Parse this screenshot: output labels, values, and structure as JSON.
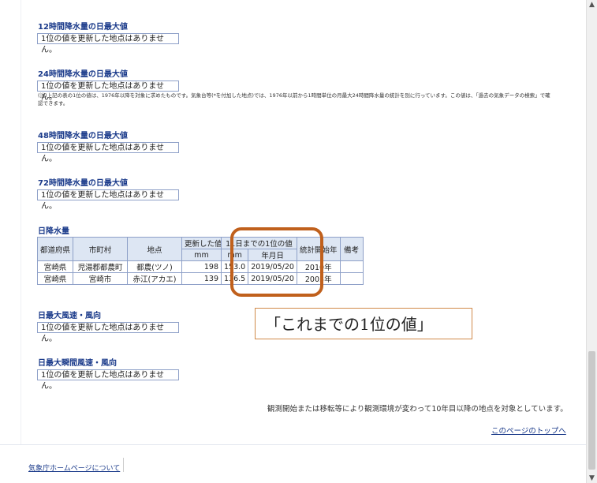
{
  "sections": {
    "s12h": {
      "title": "12時間降水量の日最大値",
      "notice": "1位の値を更新した地点はありません。"
    },
    "s24h": {
      "title": "24時間降水量の日最大値",
      "notice": "1位の値を更新した地点はありません。"
    },
    "footnote": "(注)上記の表の1位の値は、1976年以降を対象に求めたものです。気象台等(*を付加した地点)では、1976年以前から1時間単位の月最大24時間降水量の統計を別に行っています。この値は、「過去の気象データの検索」で確認できます。",
    "s48h": {
      "title": "48時間降水量の日最大値",
      "notice": "1位の値を更新した地点はありません。"
    },
    "s72h": {
      "title": "72時間降水量の日最大値",
      "notice": "1位の値を更新した地点はありません。"
    },
    "daily": {
      "title": "日降水量"
    },
    "wind": {
      "title": "日最大風速・風向",
      "notice": "1位の値を更新した地点はありません。"
    },
    "gust": {
      "title": "日最大瞬間風速・風向",
      "notice": "1位の値を更新した地点はありません。"
    }
  },
  "table": {
    "headers": {
      "pref": "都道府県",
      "city": "市町村",
      "site": "地点",
      "updated": "更新した値",
      "updated_unit": "mm",
      "prev_first": "11日までの1位の値",
      "prev_unit": "mm",
      "prev_date": "年月日",
      "start": "統計開始年",
      "remarks": "備考"
    },
    "rows": [
      {
        "pref": "宮崎県",
        "city": "児湯郡都農町",
        "site": "都農(ツノ)",
        "updated": "198",
        "prev_value": "153.0",
        "prev_date": "2019/05/20",
        "start": "2010年",
        "remarks": ""
      },
      {
        "pref": "宮崎県",
        "city": "宮崎市",
        "site": "赤江(アカエ)",
        "updated": "139",
        "prev_value": "136.5",
        "prev_date": "2019/05/20",
        "start": "2003年",
        "remarks": ""
      }
    ]
  },
  "callout": "「これまでの1位の値」",
  "bottom_note": "観測開始または移転等により観測環境が変わって10年目以降の地点を対象としています。",
  "top_link": "このページのトップへ",
  "footer_link": "気象庁ホームページについて",
  "colors": {
    "title": "#1a3a8a",
    "highlight": "#c0601c",
    "table_header_bg": "#dde6f3"
  }
}
